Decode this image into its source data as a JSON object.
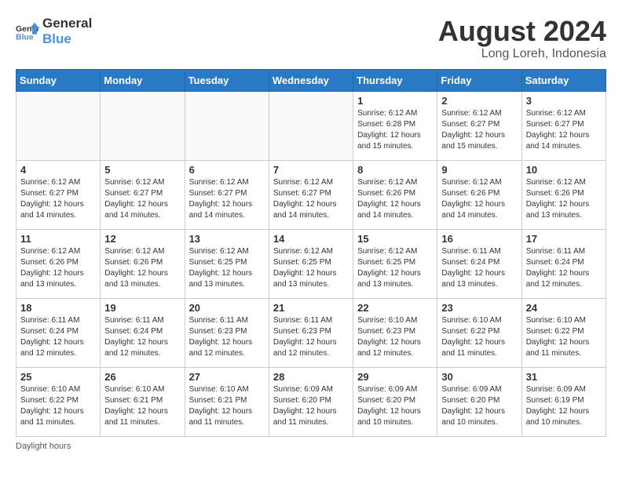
{
  "header": {
    "logo_line1": "General",
    "logo_line2": "Blue",
    "month_year": "August 2024",
    "location": "Long Loreh, Indonesia"
  },
  "weekdays": [
    "Sunday",
    "Monday",
    "Tuesday",
    "Wednesday",
    "Thursday",
    "Friday",
    "Saturday"
  ],
  "weeks": [
    [
      {
        "day": "",
        "info": ""
      },
      {
        "day": "",
        "info": ""
      },
      {
        "day": "",
        "info": ""
      },
      {
        "day": "",
        "info": ""
      },
      {
        "day": "1",
        "info": "Sunrise: 6:12 AM\nSunset: 6:28 PM\nDaylight: 12 hours and 15 minutes."
      },
      {
        "day": "2",
        "info": "Sunrise: 6:12 AM\nSunset: 6:27 PM\nDaylight: 12 hours and 15 minutes."
      },
      {
        "day": "3",
        "info": "Sunrise: 6:12 AM\nSunset: 6:27 PM\nDaylight: 12 hours and 14 minutes."
      }
    ],
    [
      {
        "day": "4",
        "info": "Sunrise: 6:12 AM\nSunset: 6:27 PM\nDaylight: 12 hours and 14 minutes."
      },
      {
        "day": "5",
        "info": "Sunrise: 6:12 AM\nSunset: 6:27 PM\nDaylight: 12 hours and 14 minutes."
      },
      {
        "day": "6",
        "info": "Sunrise: 6:12 AM\nSunset: 6:27 PM\nDaylight: 12 hours and 14 minutes."
      },
      {
        "day": "7",
        "info": "Sunrise: 6:12 AM\nSunset: 6:27 PM\nDaylight: 12 hours and 14 minutes."
      },
      {
        "day": "8",
        "info": "Sunrise: 6:12 AM\nSunset: 6:26 PM\nDaylight: 12 hours and 14 minutes."
      },
      {
        "day": "9",
        "info": "Sunrise: 6:12 AM\nSunset: 6:26 PM\nDaylight: 12 hours and 14 minutes."
      },
      {
        "day": "10",
        "info": "Sunrise: 6:12 AM\nSunset: 6:26 PM\nDaylight: 12 hours and 13 minutes."
      }
    ],
    [
      {
        "day": "11",
        "info": "Sunrise: 6:12 AM\nSunset: 6:26 PM\nDaylight: 12 hours and 13 minutes."
      },
      {
        "day": "12",
        "info": "Sunrise: 6:12 AM\nSunset: 6:26 PM\nDaylight: 12 hours and 13 minutes."
      },
      {
        "day": "13",
        "info": "Sunrise: 6:12 AM\nSunset: 6:25 PM\nDaylight: 12 hours and 13 minutes."
      },
      {
        "day": "14",
        "info": "Sunrise: 6:12 AM\nSunset: 6:25 PM\nDaylight: 12 hours and 13 minutes."
      },
      {
        "day": "15",
        "info": "Sunrise: 6:12 AM\nSunset: 6:25 PM\nDaylight: 12 hours and 13 minutes."
      },
      {
        "day": "16",
        "info": "Sunrise: 6:11 AM\nSunset: 6:24 PM\nDaylight: 12 hours and 13 minutes."
      },
      {
        "day": "17",
        "info": "Sunrise: 6:11 AM\nSunset: 6:24 PM\nDaylight: 12 hours and 12 minutes."
      }
    ],
    [
      {
        "day": "18",
        "info": "Sunrise: 6:11 AM\nSunset: 6:24 PM\nDaylight: 12 hours and 12 minutes."
      },
      {
        "day": "19",
        "info": "Sunrise: 6:11 AM\nSunset: 6:24 PM\nDaylight: 12 hours and 12 minutes."
      },
      {
        "day": "20",
        "info": "Sunrise: 6:11 AM\nSunset: 6:23 PM\nDaylight: 12 hours and 12 minutes."
      },
      {
        "day": "21",
        "info": "Sunrise: 6:11 AM\nSunset: 6:23 PM\nDaylight: 12 hours and 12 minutes."
      },
      {
        "day": "22",
        "info": "Sunrise: 6:10 AM\nSunset: 6:23 PM\nDaylight: 12 hours and 12 minutes."
      },
      {
        "day": "23",
        "info": "Sunrise: 6:10 AM\nSunset: 6:22 PM\nDaylight: 12 hours and 11 minutes."
      },
      {
        "day": "24",
        "info": "Sunrise: 6:10 AM\nSunset: 6:22 PM\nDaylight: 12 hours and 11 minutes."
      }
    ],
    [
      {
        "day": "25",
        "info": "Sunrise: 6:10 AM\nSunset: 6:22 PM\nDaylight: 12 hours and 11 minutes."
      },
      {
        "day": "26",
        "info": "Sunrise: 6:10 AM\nSunset: 6:21 PM\nDaylight: 12 hours and 11 minutes."
      },
      {
        "day": "27",
        "info": "Sunrise: 6:10 AM\nSunset: 6:21 PM\nDaylight: 12 hours and 11 minutes."
      },
      {
        "day": "28",
        "info": "Sunrise: 6:09 AM\nSunset: 6:20 PM\nDaylight: 12 hours and 11 minutes."
      },
      {
        "day": "29",
        "info": "Sunrise: 6:09 AM\nSunset: 6:20 PM\nDaylight: 12 hours and 10 minutes."
      },
      {
        "day": "30",
        "info": "Sunrise: 6:09 AM\nSunset: 6:20 PM\nDaylight: 12 hours and 10 minutes."
      },
      {
        "day": "31",
        "info": "Sunrise: 6:09 AM\nSunset: 6:19 PM\nDaylight: 12 hours and 10 minutes."
      }
    ]
  ],
  "footer": {
    "note": "Daylight hours"
  }
}
